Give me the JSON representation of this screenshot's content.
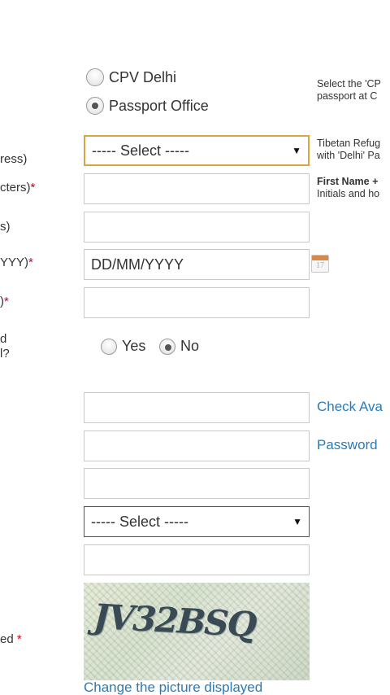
{
  "office_choice": {
    "option_cpv": "CPV Delhi",
    "option_passport_office": "Passport Office",
    "selected": "Passport Office"
  },
  "labels": {
    "passport_office_address": "ress)",
    "given_name_chars": "cters)",
    "surname": "s)",
    "dob_format": "YYY)",
    "email": ")",
    "radio_question_line1": "d",
    "radio_question_line2": "l?",
    "captcha_label": "ed"
  },
  "required_mark": "*",
  "fields": {
    "passport_office_select": "----- Select -----",
    "date_of_birth_placeholder": "DD/MM/YYYY",
    "hint_question_select": "----- Select -----"
  },
  "yes_no": {
    "yes": "Yes",
    "no": "No",
    "selected": "No"
  },
  "hints": {
    "select_cpv_line1": "Select the 'CP",
    "select_cpv_line2": "passport at C",
    "tibetan_line1": "Tibetan Refug",
    "tibetan_line2": "with 'Delhi' Pa",
    "name_bold": "First Name +",
    "name_line2": "Initials and ho"
  },
  "calendar_icon_day": "17",
  "links": {
    "check_availability": "Check Ava",
    "password_policy": "Password",
    "change_picture": "Change the picture displayed"
  },
  "captcha_text": "JV32BSQ"
}
